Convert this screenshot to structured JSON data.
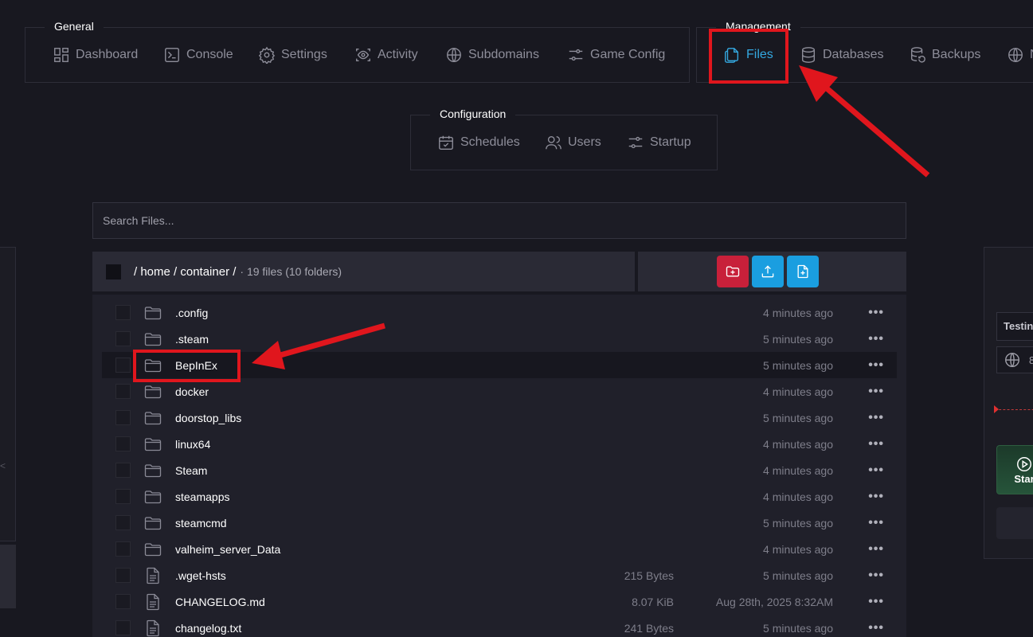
{
  "nav": {
    "general": {
      "title": "General",
      "items": [
        {
          "label": "Dashboard",
          "icon": "dashboard-icon"
        },
        {
          "label": "Console",
          "icon": "terminal-icon"
        },
        {
          "label": "Settings",
          "icon": "gear-icon"
        },
        {
          "label": "Activity",
          "icon": "eye-scan-icon"
        },
        {
          "label": "Subdomains",
          "icon": "globe-icon"
        },
        {
          "label": "Game Config",
          "icon": "sliders-icon"
        }
      ]
    },
    "management": {
      "title": "Management",
      "items": [
        {
          "label": "Files",
          "icon": "files-icon",
          "active": true
        },
        {
          "label": "Databases",
          "icon": "database-icon"
        },
        {
          "label": "Backups",
          "icon": "backup-icon"
        },
        {
          "label": "N",
          "icon": "globe-icon"
        }
      ]
    },
    "configuration": {
      "title": "Configuration",
      "items": [
        {
          "label": "Schedules",
          "icon": "calendar-icon"
        },
        {
          "label": "Users",
          "icon": "users-icon"
        },
        {
          "label": "Startup",
          "icon": "sliders-icon"
        }
      ]
    }
  },
  "search": {
    "placeholder": "Search Files..."
  },
  "path": {
    "text": "/ home / container /",
    "count": "· 19 files (10 folders)"
  },
  "actions": [
    {
      "name": "new-folder",
      "icon": "folder-plus-icon",
      "color": "#c8203a"
    },
    {
      "name": "upload",
      "icon": "upload-icon",
      "color": "#1a9ee0"
    },
    {
      "name": "new-file",
      "icon": "file-plus-icon",
      "color": "#1a9ee0"
    }
  ],
  "files": [
    {
      "name": ".config",
      "type": "folder",
      "size": "",
      "date": "4 minutes ago"
    },
    {
      "name": ".steam",
      "type": "folder",
      "size": "",
      "date": "5 minutes ago"
    },
    {
      "name": "BepInEx",
      "type": "folder",
      "size": "",
      "date": "5 minutes ago"
    },
    {
      "name": "docker",
      "type": "folder",
      "size": "",
      "date": "4 minutes ago"
    },
    {
      "name": "doorstop_libs",
      "type": "folder",
      "size": "",
      "date": "5 minutes ago"
    },
    {
      "name": "linux64",
      "type": "folder",
      "size": "",
      "date": "4 minutes ago"
    },
    {
      "name": "Steam",
      "type": "folder",
      "size": "",
      "date": "4 minutes ago"
    },
    {
      "name": "steamapps",
      "type": "folder",
      "size": "",
      "date": "4 minutes ago"
    },
    {
      "name": "steamcmd",
      "type": "folder",
      "size": "",
      "date": "5 minutes ago"
    },
    {
      "name": "valheim_server_Data",
      "type": "folder",
      "size": "",
      "date": "4 minutes ago"
    },
    {
      "name": ".wget-hsts",
      "type": "file",
      "size": "215 Bytes",
      "date": "5 minutes ago"
    },
    {
      "name": "CHANGELOG.md",
      "type": "file",
      "size": "8.07 KiB",
      "date": "Aug 28th, 2025 8:32AM"
    },
    {
      "name": "changelog.txt",
      "type": "file",
      "size": "241 Bytes",
      "date": "5 minutes ago"
    }
  ],
  "row_menu": "•••",
  "right_panel": {
    "server_name": "Testin",
    "address": "8",
    "start_label": "Star"
  },
  "left_panel": {
    "glyph": "<"
  },
  "colors": {
    "accent": "#34a8e0",
    "highlight": "#e0161d",
    "background": "#181820"
  }
}
